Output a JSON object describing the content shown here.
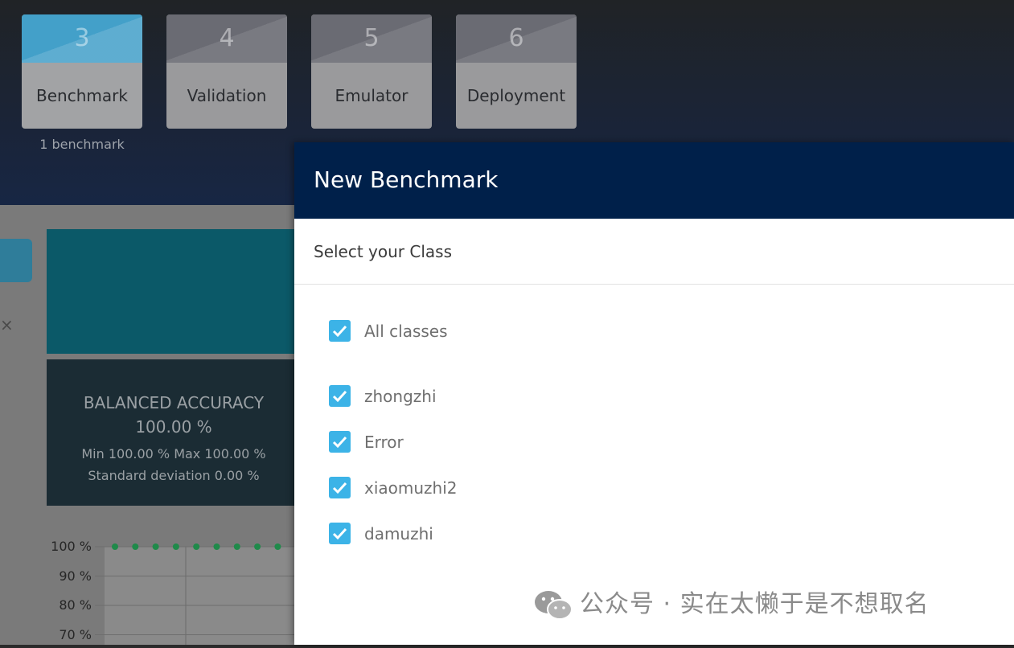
{
  "steps": [
    {
      "number": "3",
      "label": "Benchmark",
      "sublabel": "1 benchmark",
      "active": true
    },
    {
      "number": "4",
      "label": "Validation",
      "sublabel": "",
      "active": false
    },
    {
      "number": "5",
      "label": "Emulator",
      "sublabel": "",
      "active": false
    },
    {
      "number": "6",
      "label": "Deployment",
      "sublabel": "",
      "active": false
    }
  ],
  "background_page": {
    "close_glyph": "×",
    "accuracy": {
      "title": "BALANCED ACCURACY",
      "value": "100.00 %",
      "min_max": "Min 100.00 % Max 100.00 %",
      "std": "Standard deviation 0.00 %"
    },
    "chart_data": {
      "type": "scatter",
      "y_tick_labels": [
        "100 %",
        "90 %",
        "80 %",
        "70 %"
      ],
      "y_ticks": [
        100,
        90,
        80,
        70
      ],
      "x": [
        1,
        2,
        3,
        4,
        5,
        6,
        7,
        8,
        9
      ],
      "values": [
        100,
        100,
        100,
        100,
        100,
        100,
        100,
        100,
        100
      ],
      "ylim": [
        70,
        100
      ],
      "grid": true,
      "point_color": "#1f8a4a"
    }
  },
  "modal": {
    "title": "New Benchmark",
    "subtitle": "Select your Class",
    "options": [
      {
        "label": "All classes",
        "checked": true
      },
      {
        "label": "zhongzhi",
        "checked": true
      },
      {
        "label": "Error",
        "checked": true
      },
      {
        "label": "xiaomuzhi2",
        "checked": true
      },
      {
        "label": "damuzhi",
        "checked": true
      }
    ]
  },
  "watermark": {
    "icon": "wechat-icon",
    "text": "公众号 · 实在太懒于是不想取名"
  },
  "colors": {
    "accent": "#3cb3e7",
    "modal_header": "#00204a",
    "active_step": "#43a0c9"
  }
}
